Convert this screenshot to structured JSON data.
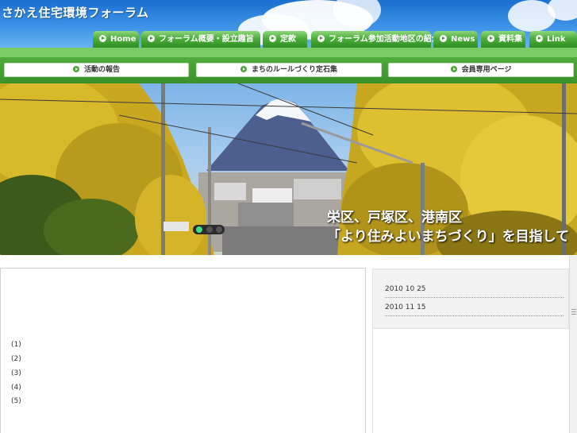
{
  "site": {
    "title": "さかえ住宅環境フォーラム"
  },
  "nav": {
    "tabs": [
      {
        "label": "Home"
      },
      {
        "label": "フォーラム概要・設立趣旨"
      },
      {
        "label": "定款"
      },
      {
        "label": "フォーラム参加活動地区の紹介"
      },
      {
        "label": "News"
      },
      {
        "label": "資料集"
      },
      {
        "label": "Link"
      }
    ]
  },
  "subnav": {
    "buttons": [
      {
        "label": "活動の報告"
      },
      {
        "label": "まちのルールづくり定石集"
      },
      {
        "label": "会員専用ページ"
      }
    ]
  },
  "hero": {
    "line1": "栄区、戸塚区、港南区",
    "line2": "「より住みよいまちづくり」を目指して"
  },
  "main": {
    "items": [
      "(1)",
      "(2)",
      "(3)",
      "(4)",
      "(5)"
    ]
  },
  "news": {
    "entries": [
      {
        "date": "2010 10 25"
      },
      {
        "date": "2010 11 15"
      }
    ]
  },
  "colors": {
    "nav_green": "#4cae3a",
    "band_green": "#48a334",
    "sky_blue": "#3d92e6",
    "ginkgo_yellow": "#e2c230"
  },
  "icons": [
    "play-circle-icon",
    "scroll-grip-icon"
  ]
}
